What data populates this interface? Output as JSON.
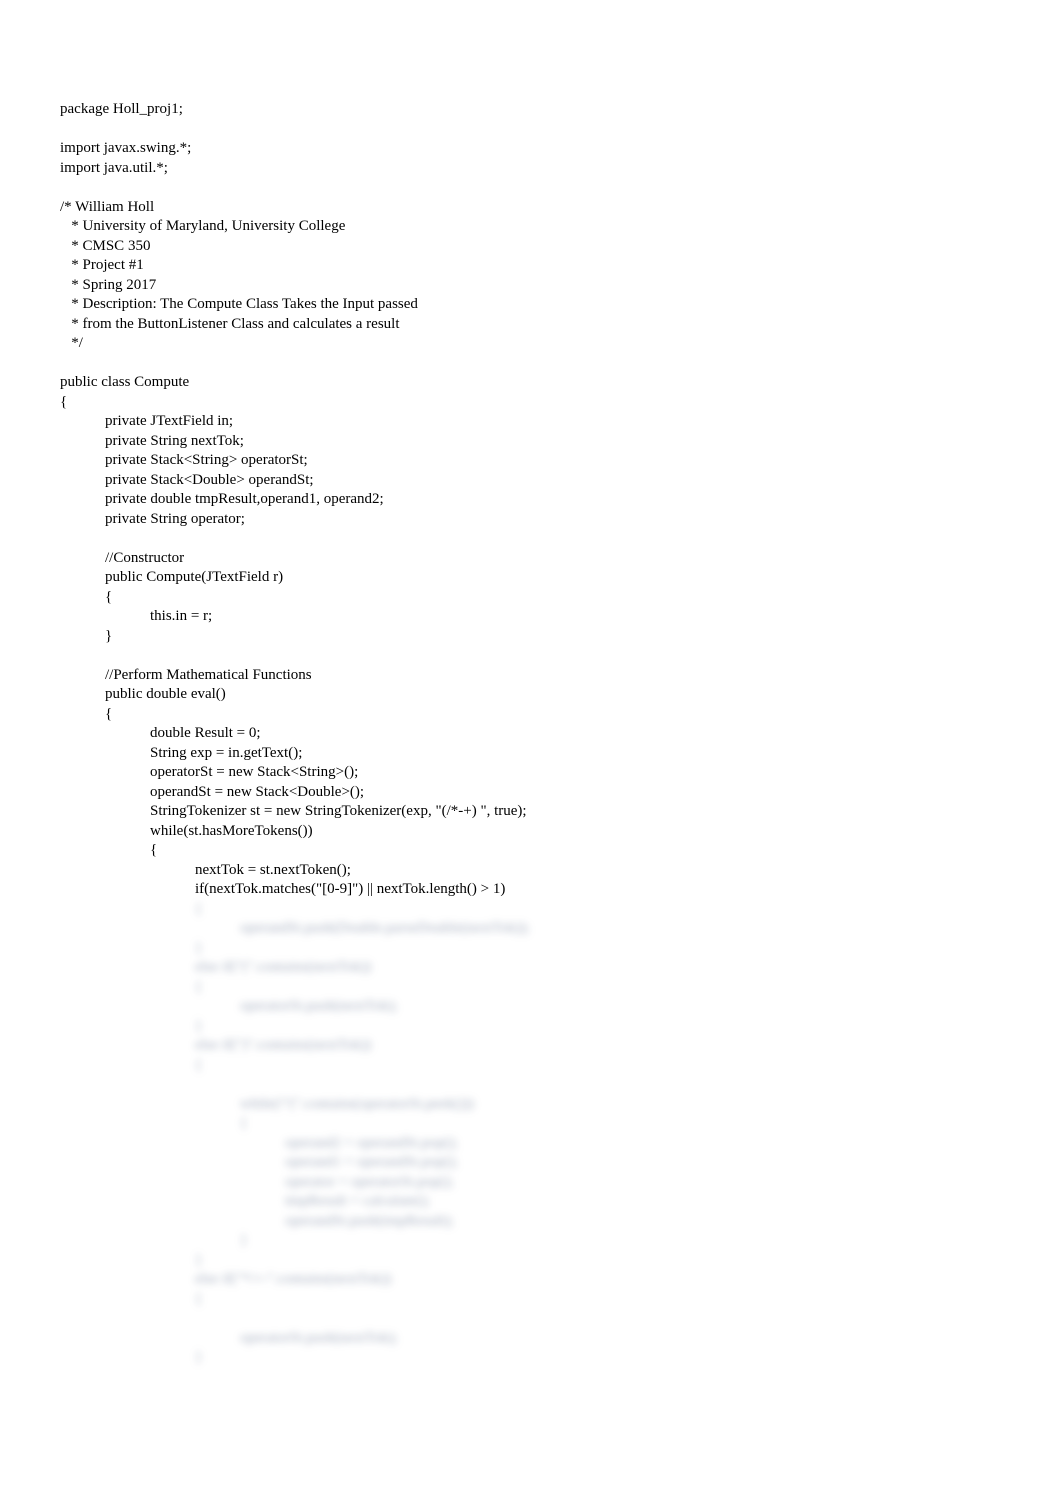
{
  "code": {
    "lines": [
      "package Holl_proj1;",
      "",
      "import javax.swing.*;",
      "import java.util.*;",
      "",
      "/* William Holl",
      "   * University of Maryland, University College",
      "   * CMSC 350",
      "   * Project #1",
      "   * Spring 2017",
      "   * Description: The Compute Class Takes the Input passed",
      "   * from the ButtonListener Class and calculates a result",
      "   */",
      "",
      "public class Compute",
      "{",
      "            private JTextField in;",
      "            private String nextTok;",
      "            private Stack<String> operatorSt;",
      "            private Stack<Double> operandSt;",
      "            private double tmpResult,operand1, operand2;",
      "            private String operator;",
      "",
      "            //Constructor",
      "            public Compute(JTextField r)",
      "            {",
      "                        this.in = r;",
      "            }",
      "",
      "            //Perform Mathematical Functions",
      "            public double eval()",
      "            {",
      "                        double Result = 0;",
      "                        String exp = in.getText();",
      "                        operatorSt = new Stack<String>();",
      "                        operandSt = new Stack<Double>();",
      "                        StringTokenizer st = new StringTokenizer(exp, \"(/*-+) \", true);",
      "                        while(st.hasMoreTokens())",
      "                        {",
      "                                    nextTok = st.nextToken();",
      "                                    if(nextTok.matches(\"[0-9]\") || nextTok.length() > 1)"
    ],
    "blurred": [
      "                                    {",
      "                                                operandSt.push(Double.parseDouble(nextTok));",
      "                                    }",
      "                                    else if(\"(\".contains(nextTok))",
      "                                    {",
      "                                                operatorSt.push(nextTok);",
      "                                    }",
      "                                    else if(\")\".contains(nextTok))",
      "                                    {",
      "",
      "                                                while(!\"(\".contains(operatorSt.peek()))",
      "                                                {",
      "                                                            operand2 = operandSt.pop();",
      "                                                            operand1 = operandSt.pop();",
      "                                                            operator = operatorSt.pop();",
      "                                                            tmpResult = calculate();",
      "                                                            operandSt.push(tmpResult);",
      "                                                }",
      "                                    }",
      "                                    else if(\"*/+-\".contains(nextTok))",
      "                                    {",
      "",
      "                                                operatorSt.push(nextTok);",
      "                                    }"
    ]
  }
}
